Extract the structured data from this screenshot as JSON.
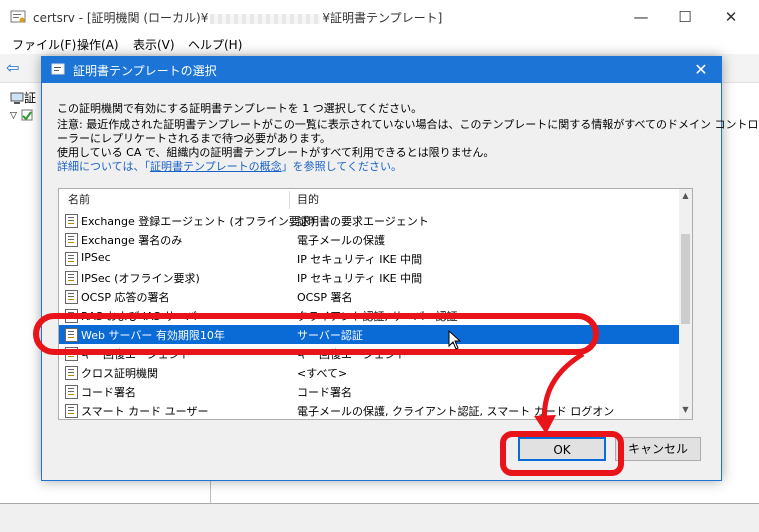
{
  "window": {
    "title_prefix": "certsrv - [証明機関 (ローカル)¥",
    "title_suffix": "¥証明書テンプレート]",
    "minimize": "—",
    "maximize": "☐",
    "close": "✕"
  },
  "menu": [
    "ファイル(F)",
    "操作(A)",
    "表示(V)",
    "ヘルプ(H)"
  ],
  "tree": {
    "item1": "証",
    "item2": ""
  },
  "dialog": {
    "title": "証明書テンプレートの選択",
    "close": "✕",
    "text_lines": [
      "この証明機関で有効にする証明書テンプレートを 1 つ選択してください。",
      "注意: 最近作成された証明書テンプレートがこの一覧に表示されていない場合は、このテンプレートに関する情報がすべてのドメイン コントロ",
      "ーラーにレプリケートされるまで待つ必要があります。",
      "使用している CA で、組織内の証明書テンプレートがすべて利用できるとは限りません。"
    ],
    "link_prefix": "詳細については、「",
    "link_text": "証明書テンプレートの概念",
    "link_suffix": "」を参照してください。",
    "columns": [
      "名前",
      "目的"
    ],
    "rows": [
      {
        "name": "Exchange 登録エージェント (オフライン要求)",
        "purpose": "証明書の要求エージェント"
      },
      {
        "name": "Exchange 署名のみ",
        "purpose": "電子メールの保護"
      },
      {
        "name": "IPSec",
        "purpose": "IP セキュリティ IKE 中間"
      },
      {
        "name": "IPSec (オフライン要求)",
        "purpose": "IP セキュリティ IKE 中間"
      },
      {
        "name": "OCSP 応答の署名",
        "purpose": "OCSP 署名"
      },
      {
        "name": "RAS および IAS サーバー",
        "purpose": "クライアント認証, サーバー認証"
      },
      {
        "name": "Web サーバー 有効期限10年",
        "purpose": "サーバー認証"
      },
      {
        "name": "キー回復エージェント",
        "purpose": "キー回復エージェント"
      },
      {
        "name": "クロス証明機関",
        "purpose": "<すべて>"
      },
      {
        "name": "コード署名",
        "purpose": "コード署名"
      },
      {
        "name": "スマート カード ユーザー",
        "purpose": "電子メールの保護, クライアント認証, スマート カード ログオン"
      }
    ],
    "selected_row": 6,
    "ok": "OK",
    "cancel": "キャンセル"
  },
  "colors": {
    "accent": "#1b74d6",
    "selection": "#0a6ad6",
    "annotation": "#e8141a"
  }
}
